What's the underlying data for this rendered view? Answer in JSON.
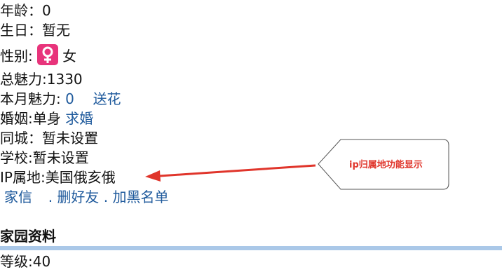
{
  "profile": {
    "age_label": "年龄：",
    "age_value": "0",
    "birthday_label": "生日：",
    "birthday_value": "暂无",
    "gender_label": "性别:",
    "gender_icon": "female-symbol-icon",
    "gender_value": "女",
    "total_charm_label": "总魅力:",
    "total_charm_value": "1330",
    "month_charm_label": "本月魅力:",
    "month_charm_value": "0",
    "send_flower_link": "送花",
    "marriage_label": "婚姻:",
    "marriage_value": "单身",
    "propose_link": "求婚",
    "same_city_label": "同城：",
    "same_city_value": "暂未设置",
    "school_label": "学校:",
    "school_value": "暂未设置",
    "ip_label": "IP属地:",
    "ip_value": "美国俄亥俄"
  },
  "actions": {
    "message_link": "家信",
    "separator_1": ".",
    "delete_friend_link": "删好友",
    "separator_2": ".",
    "blacklist_link": "加黑名单"
  },
  "home_section": {
    "title": "家园资料",
    "level_label": "等级:",
    "level_value": "40"
  },
  "annotation": {
    "callout_text": "ip归属地功能显示",
    "arrow_color": "#e0352b",
    "badge_color": "#e8347b",
    "link_color": "#1f5a9c",
    "divider_color": "#aac8e8"
  }
}
